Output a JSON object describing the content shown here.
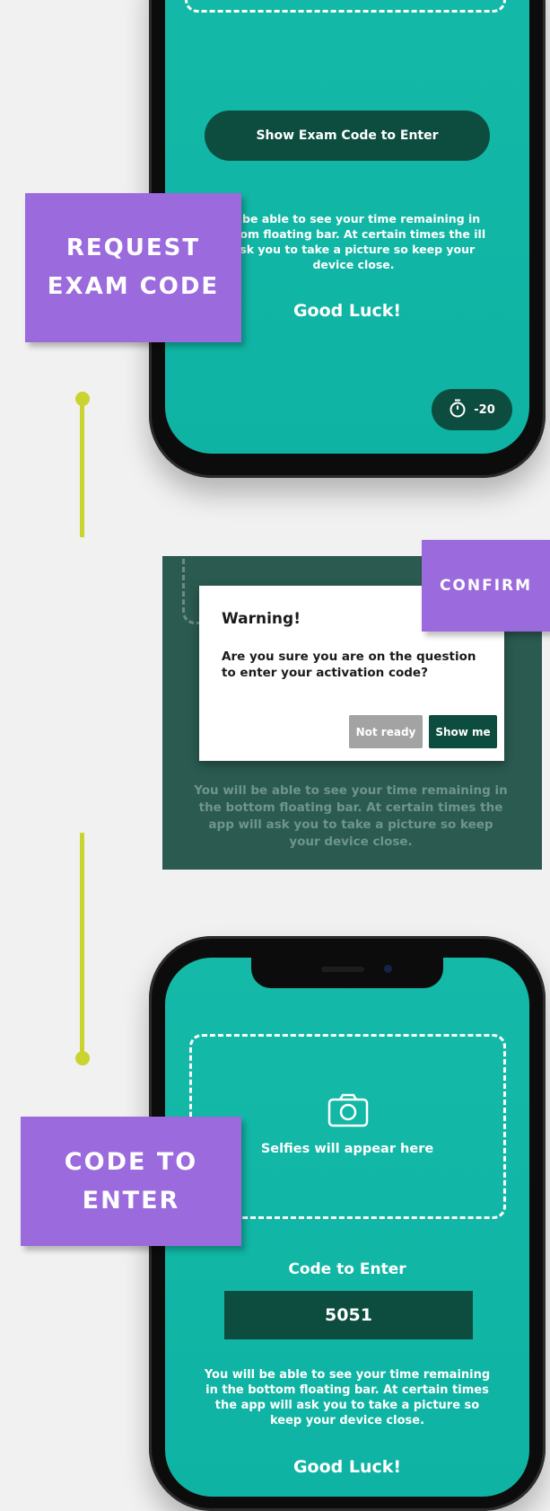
{
  "labels": {
    "request_exam_code": "REQUEST EXAM CODE",
    "confirm": "CONFIRM",
    "code_to_enter": "CODE TO ENTER"
  },
  "screen1": {
    "show_code_button": "Show Exam Code to Enter",
    "info_text": "ill be able to see your time remaining in ottom floating bar. At certain times the ill ask you to take a picture so keep your device close.",
    "good_luck": "Good Luck!",
    "timer_value": "-20",
    "timer_icon": "stopwatch-icon"
  },
  "dialog": {
    "title": "Warning!",
    "message": "Are you sure you are on the question to enter your activation code?",
    "not_ready": "Not ready",
    "show_me": "Show me",
    "background_text": "You will be able to see your time remaining in the bottom floating bar. At certain times the app will ask you to take a picture so keep your device close."
  },
  "screen2": {
    "camera_icon": "camera-icon",
    "selfies_text": "Selfies will appear here",
    "code_heading": "Code to Enter",
    "code_value": "5051",
    "info_text": "You will be able to see your time remaining in the bottom floating bar. At certain times the app will ask you to take a picture so keep your device close.",
    "good_luck": "Good Luck!"
  },
  "colors": {
    "teal": "#14b9a8",
    "dark_green": "#0d4d3f",
    "purple": "#9b6add",
    "lime": "#c9d431",
    "gray_button": "#a3a3a3"
  }
}
